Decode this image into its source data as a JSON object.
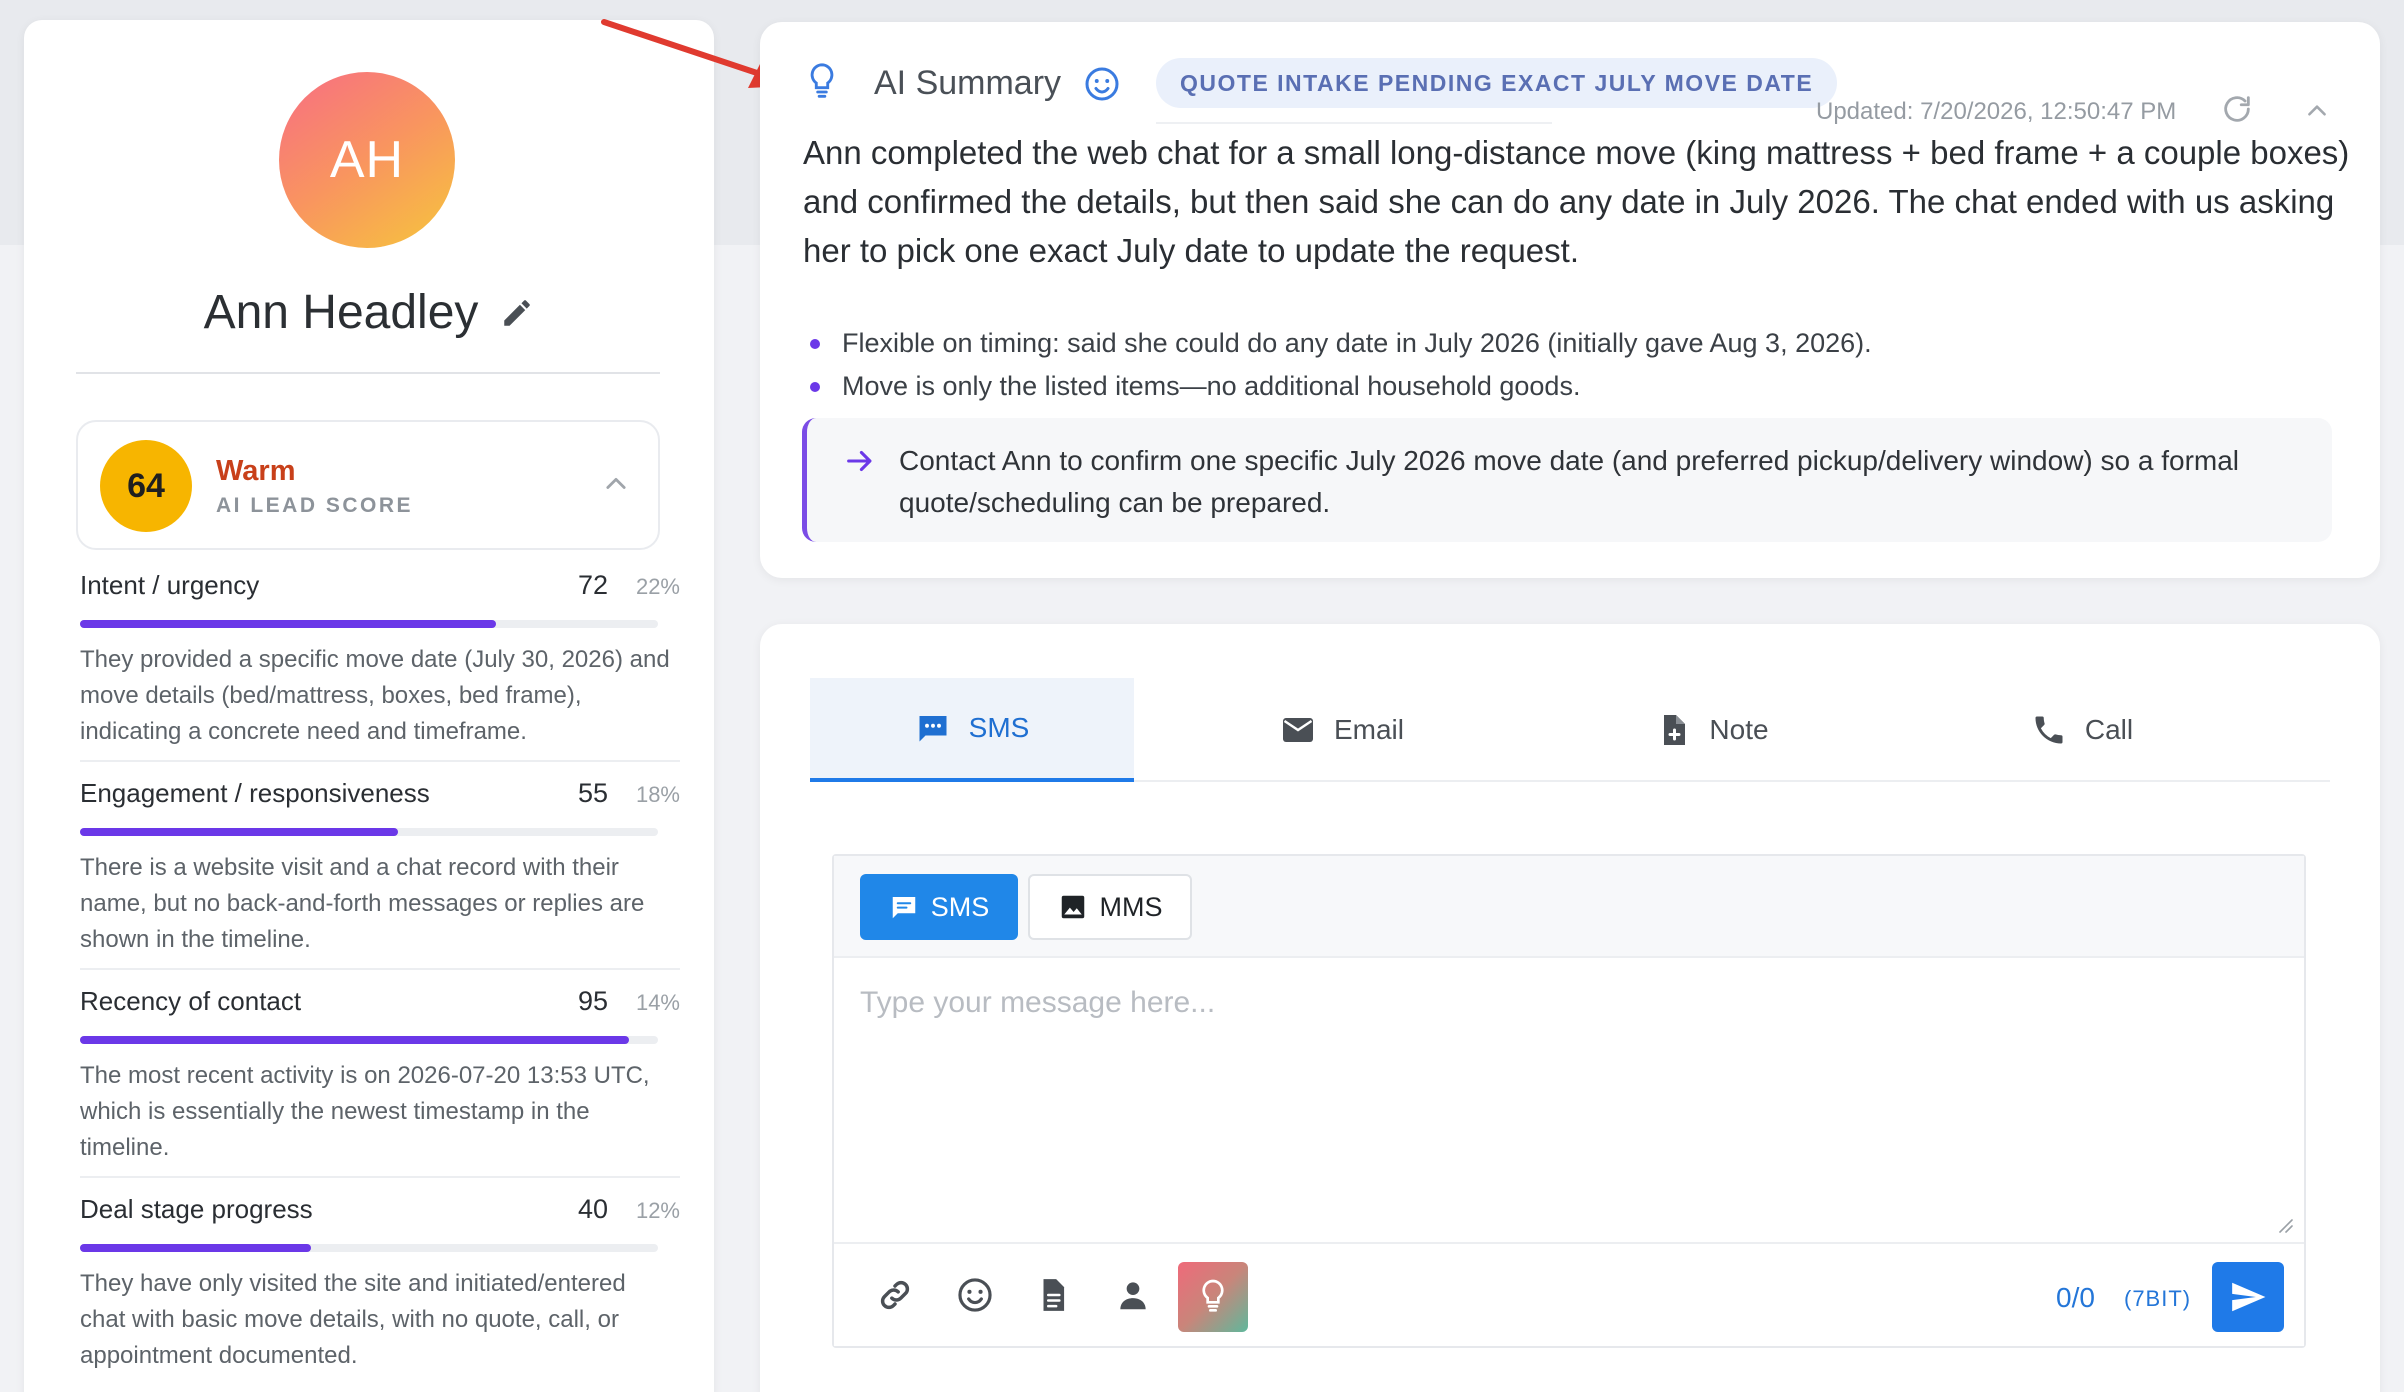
{
  "contact": {
    "initials": "AH",
    "name": "Ann Headley"
  },
  "lead_score": {
    "value": "64",
    "label": "Warm",
    "sublabel": "AI LEAD SCORE"
  },
  "metrics": [
    {
      "name": "Intent / urgency",
      "score": "72",
      "weight": "22%",
      "fill": 0.72,
      "description": "They provided a specific move date (July 30, 2026) and move details (bed/mattress, boxes, bed frame), indicating a concrete need and timeframe."
    },
    {
      "name": "Engagement / responsiveness",
      "score": "55",
      "weight": "18%",
      "fill": 0.55,
      "description": "There is a website visit and a chat record with their name, but no back-and-forth messages or replies are shown in the timeline."
    },
    {
      "name": "Recency of contact",
      "score": "95",
      "weight": "14%",
      "fill": 0.95,
      "description": "The most recent activity is on 2026-07-20 13:53 UTC, which is essentially the newest timestamp in the timeline."
    },
    {
      "name": "Deal stage progress",
      "score": "40",
      "weight": "12%",
      "fill": 0.4,
      "description": "They have only visited the site and initiated/entered chat with basic move details, with no quote, call, or appointment documented."
    }
  ],
  "summary": {
    "title": "AI Summary",
    "status": "QUOTE INTAKE PENDING EXACT JULY MOVE DATE",
    "updated": "Updated: 7/20/2026, 12:50:47 PM",
    "body": "Ann completed the web chat for a small long-distance move (king mattress + bed frame + a couple boxes) and confirmed the details, but then said she can do any date in July 2026. The chat ended with us asking her to pick one exact July date to update the request.",
    "bullets": [
      "Flexible on timing: said she could do any date in July 2026 (initially gave Aug 3, 2026).",
      "Move is only the listed items—no additional household goods."
    ],
    "next_action": "Contact Ann to confirm one specific July 2026 move date (and preferred pickup/delivery window) so a formal quote/scheduling can be prepared."
  },
  "composer": {
    "tabs": [
      {
        "label": "SMS",
        "icon": "chat-bubble-icon",
        "active": true
      },
      {
        "label": "Email",
        "icon": "envelope-icon",
        "active": false
      },
      {
        "label": "Note",
        "icon": "note-add-icon",
        "active": false
      },
      {
        "label": "Call",
        "icon": "phone-icon",
        "active": false
      }
    ],
    "mode_sms": "SMS",
    "mode_mms": "MMS",
    "placeholder": "Type your message here...",
    "char_count": "0/0",
    "encoding": "(7BIT)"
  },
  "colors": {
    "accent": "#1f7ae8",
    "metric_bar": "#6b38e8",
    "score_badge": "#f7b500",
    "warm_label": "#c8401a",
    "annotation_arrow": "#e03a2f"
  }
}
